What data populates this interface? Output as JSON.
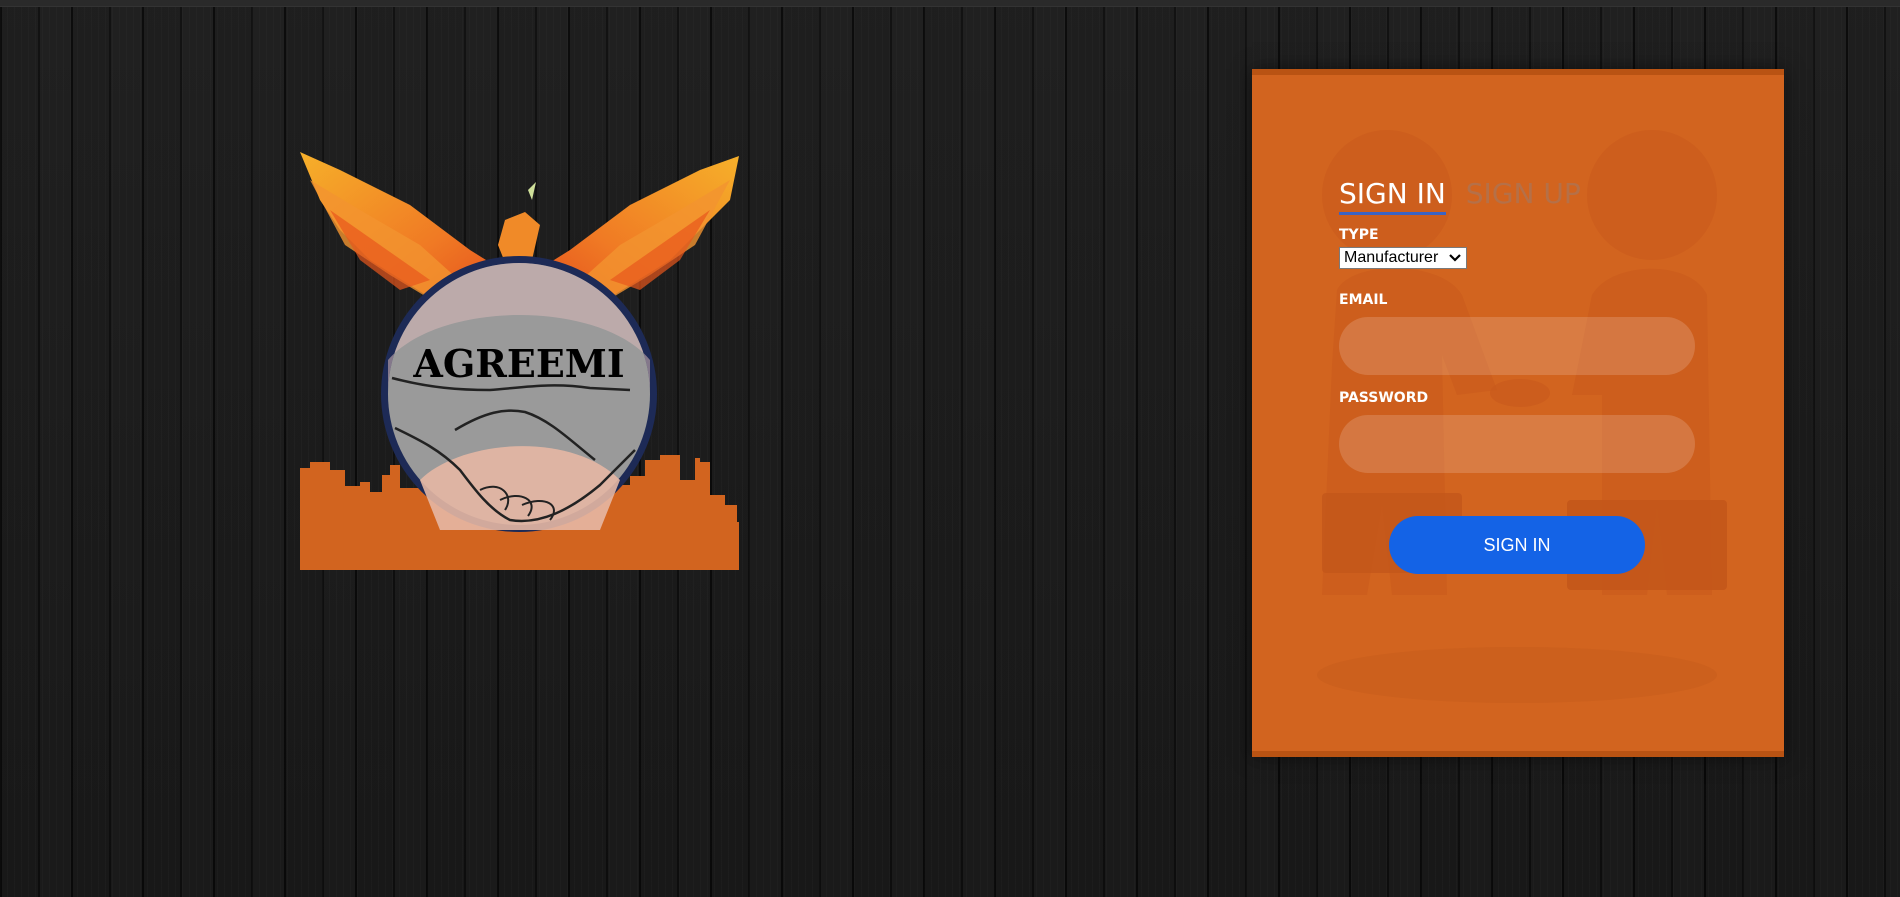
{
  "logo": {
    "brand_text": "AGREEMI"
  },
  "login": {
    "tabs": [
      {
        "label": "SIGN IN",
        "active": true
      },
      {
        "label": "SIGN UP",
        "active": false
      }
    ],
    "type_label": "TYPE",
    "type_selected": "Manufacturer",
    "email_label": "EMAIL",
    "email_value": "",
    "password_label": "PASSWORD",
    "password_value": "",
    "submit_label": "SIGN IN"
  },
  "colors": {
    "card": "#d2641f",
    "button": "#1463e6",
    "tab_underline": "#3a63c4",
    "background": "#161616"
  },
  "icons": {
    "select_chevron": "chevron-down-icon"
  }
}
